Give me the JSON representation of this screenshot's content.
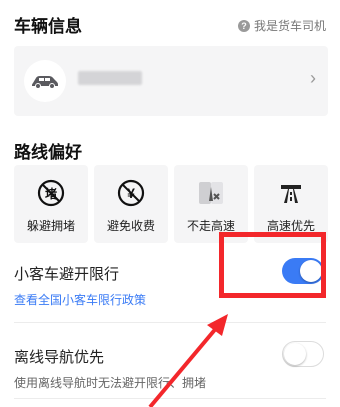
{
  "header": {
    "vehicle_title": "车辆信息",
    "driver_link": "我是货车司机",
    "driver_icon_glyph": "?"
  },
  "vehicle_card": {
    "chevron": "›"
  },
  "route": {
    "title": "路线偏好",
    "options": [
      {
        "label": "躲避拥堵",
        "icon": "avoid-congestion-icon",
        "glyph": "堵"
      },
      {
        "label": "避免收费",
        "icon": "avoid-toll-icon",
        "glyph": "¥"
      },
      {
        "label": "不走高速",
        "icon": "no-highway-icon",
        "glyph": ""
      },
      {
        "label": "高速优先",
        "icon": "highway-first-icon",
        "glyph": ""
      }
    ]
  },
  "car_restriction": {
    "label": "小客车避开限行",
    "link": "查看全国小客车限行政策",
    "enabled": true
  },
  "offline_nav": {
    "label": "离线导航优先",
    "desc": "使用离线导航时无法避开限行、拥堵",
    "enabled": false
  },
  "colors": {
    "accent": "#3a7bf5",
    "annotation": "#f3272b"
  }
}
